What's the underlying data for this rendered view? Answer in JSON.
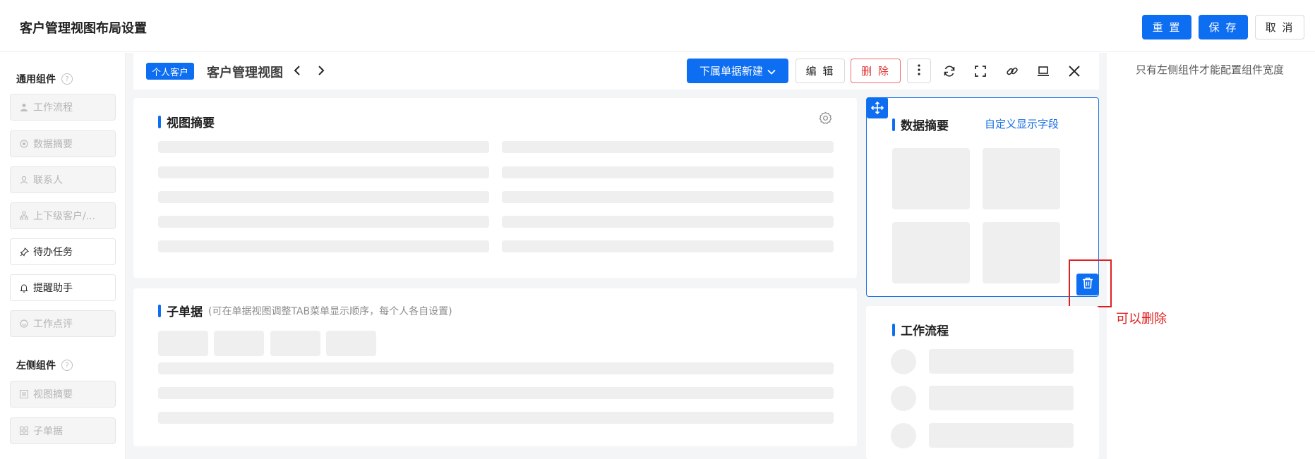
{
  "header": {
    "title": "客户管理视图布局设置",
    "reset_label": "重 置",
    "save_label": "保 存",
    "cancel_label": "取 消"
  },
  "left_panel": {
    "common_group_title": "通用组件",
    "common_items": [
      {
        "label": "工作流程",
        "icon": "person-icon",
        "state": "disabled"
      },
      {
        "label": "数据摘要",
        "icon": "circle-dot-icon",
        "state": "disabled"
      },
      {
        "label": "联系人",
        "icon": "user-outline-icon",
        "state": "disabled"
      },
      {
        "label": "上下级客户/...",
        "icon": "hierarchy-icon",
        "state": "disabled"
      },
      {
        "label": "待办任务",
        "icon": "pin-icon",
        "state": "active"
      },
      {
        "label": "提醒助手",
        "icon": "bell-icon",
        "state": "active"
      },
      {
        "label": "工作点评",
        "icon": "smile-icon",
        "state": "disabled"
      }
    ],
    "left_group_title": "左侧组件",
    "left_items": [
      {
        "label": "视图摘要",
        "icon": "list-icon",
        "state": "disabled"
      },
      {
        "label": "子单据",
        "icon": "grid-icon",
        "state": "disabled"
      }
    ]
  },
  "toolbar": {
    "tag": "个人客户",
    "view_title": "客户管理视图",
    "new_sub_label": "下属单据新建",
    "edit_label": "编 辑",
    "delete_label": "删 除"
  },
  "cards": {
    "view_summary_title": "视图摘要",
    "sub_doc_title": "子单据",
    "sub_doc_note": "(可在单据视图调整TAB菜单显示顺序，每个人各自设置)",
    "data_summary_title": "数据摘要",
    "custom_fields_link": "自定义显示字段",
    "workflow_title": "工作流程"
  },
  "annotation": {
    "can_delete": "可以删除"
  },
  "right_note": "只有左侧组件才能配置组件宽度",
  "colors": {
    "primary": "#0d6ef2",
    "danger": "#e03535",
    "annotation": "#e02020"
  }
}
